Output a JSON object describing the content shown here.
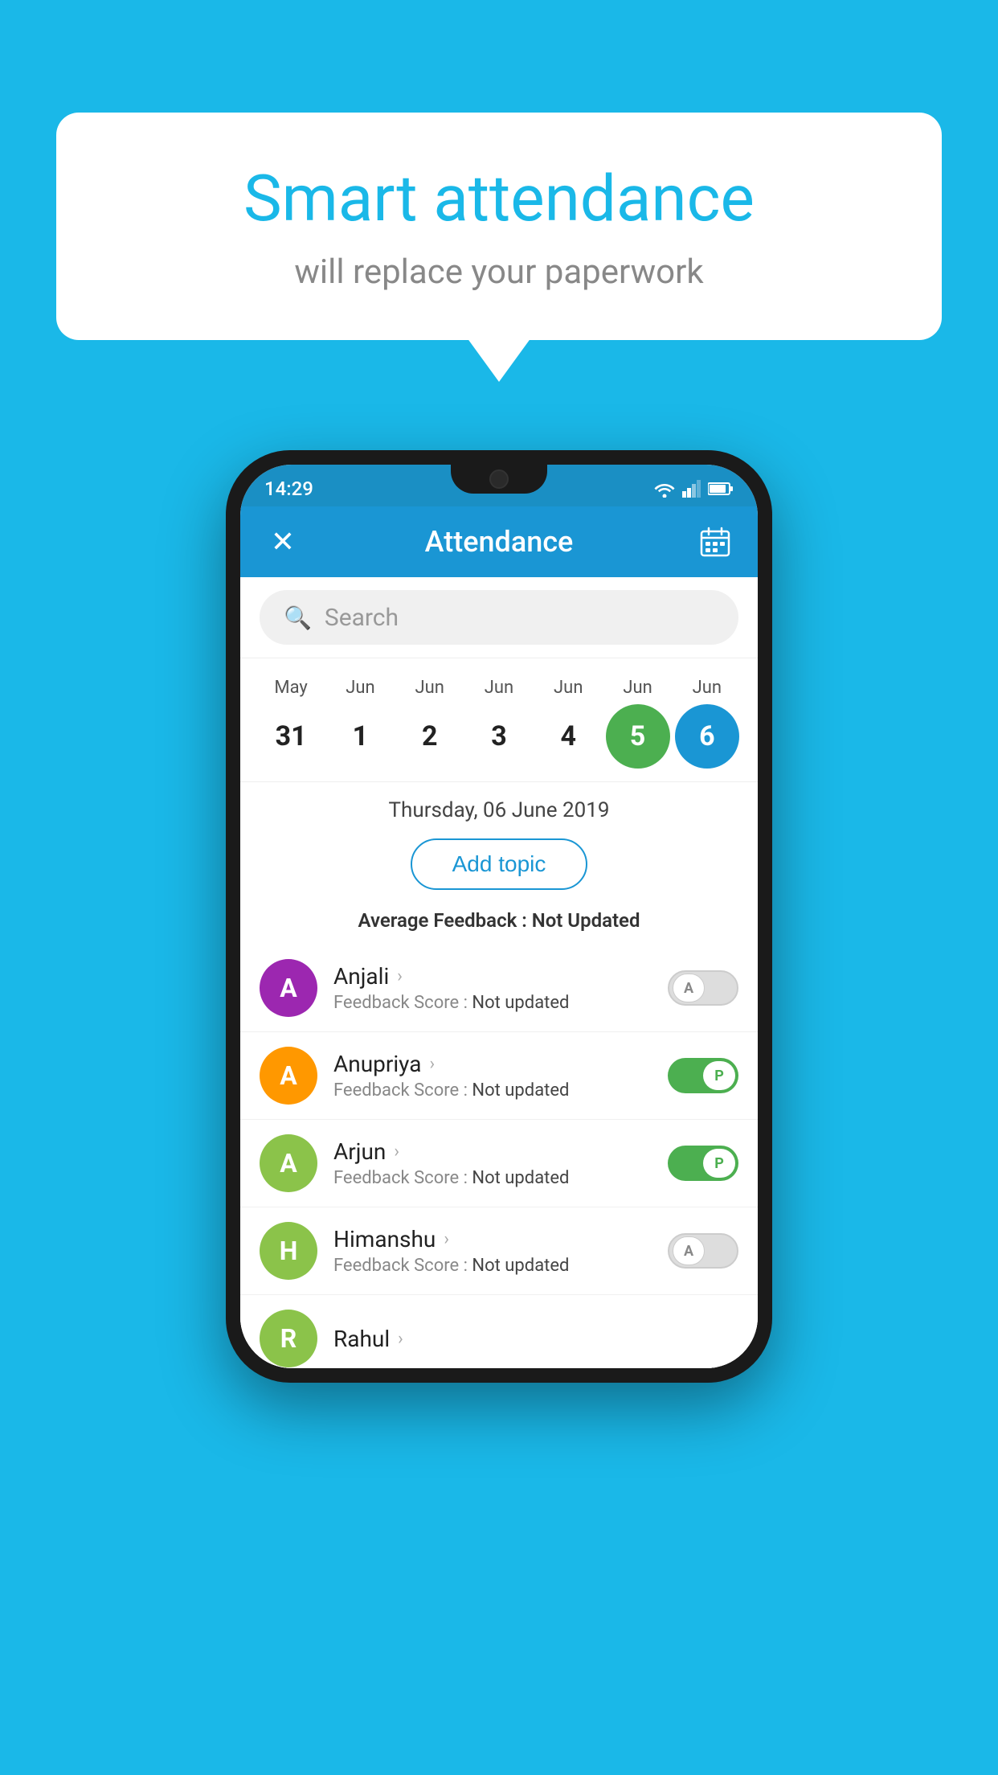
{
  "background_color": "#1ab8e8",
  "speech_bubble": {
    "title": "Smart attendance",
    "subtitle": "will replace your paperwork"
  },
  "status_bar": {
    "time": "14:29"
  },
  "app_bar": {
    "title": "Attendance",
    "close_label": "✕",
    "calendar_label": "📅"
  },
  "search": {
    "placeholder": "Search"
  },
  "calendar": {
    "months": [
      "May",
      "Jun",
      "Jun",
      "Jun",
      "Jun",
      "Jun",
      "Jun"
    ],
    "dates": [
      "31",
      "1",
      "2",
      "3",
      "4",
      "5",
      "6"
    ],
    "today_index": 5,
    "selected_index": 6
  },
  "selected_date": "Thursday, 06 June 2019",
  "add_topic_label": "Add topic",
  "average_feedback": {
    "label": "Average Feedback : ",
    "value": "Not Updated"
  },
  "students": [
    {
      "name": "Anjali",
      "avatar_letter": "A",
      "avatar_color": "#9c27b0",
      "feedback": "Not updated",
      "status": "absent"
    },
    {
      "name": "Anupriya",
      "avatar_letter": "A",
      "avatar_color": "#ff9800",
      "feedback": "Not updated",
      "status": "present"
    },
    {
      "name": "Arjun",
      "avatar_letter": "A",
      "avatar_color": "#8bc34a",
      "feedback": "Not updated",
      "status": "present"
    },
    {
      "name": "Himanshu",
      "avatar_letter": "H",
      "avatar_color": "#8bc34a",
      "feedback": "Not updated",
      "status": "absent"
    }
  ],
  "feedback_label": "Feedback Score : ",
  "feedback_not_updated": "Not updated",
  "toggle_present": "P",
  "toggle_absent": "A"
}
